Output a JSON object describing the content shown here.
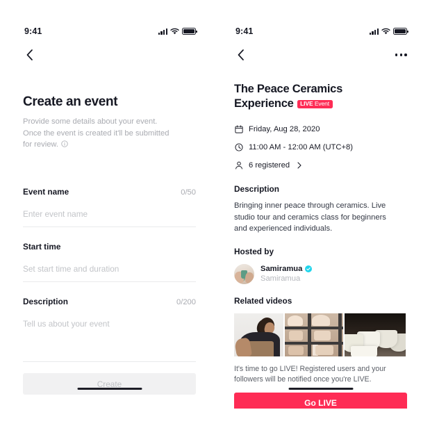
{
  "theme": {
    "accent": "#FE2C55",
    "text_primary": "#161823",
    "text_muted": "#A9ABB1",
    "divider": "#E9EAEC",
    "disabled_bg": "#F1F1F2",
    "verified_blue": "#20D5EC"
  },
  "left_screen": {
    "status_bar": {
      "time": "9:41",
      "signal_icon": "cellular-signal-icon",
      "wifi_icon": "wifi-icon",
      "battery_icon": "battery-icon"
    },
    "nav": {
      "back_icon": "chevron-left-icon"
    },
    "title": "Create an event",
    "subtitle": "Provide some details about your event. Once the event is created it'll be submitted for review.",
    "subtitle_info_icon": "info-circle-icon",
    "fields": [
      {
        "label": "Event name",
        "counter": "0/50",
        "placeholder": "Enter event name",
        "value": ""
      },
      {
        "label": "Start time",
        "counter": "",
        "placeholder": "Set start time and duration",
        "value": ""
      },
      {
        "label": "Description",
        "counter": "0/200",
        "placeholder": "Tell us about your event",
        "value": ""
      }
    ],
    "submit_label": "Create",
    "submit_enabled": false
  },
  "right_screen": {
    "status_bar": {
      "time": "9:41",
      "signal_icon": "cellular-signal-icon",
      "wifi_icon": "wifi-icon",
      "battery_icon": "battery-icon"
    },
    "nav": {
      "back_icon": "chevron-left-icon",
      "more_icon": "more-horizontal-icon"
    },
    "event_title": "The Peace Ceramics Experience",
    "live_badge": {
      "strong": "LIVE",
      "rest": " Event"
    },
    "meta": [
      {
        "icon": "calendar-icon",
        "text": "Friday, Aug 28, 2020",
        "chevron": false
      },
      {
        "icon": "clock-icon",
        "text": "11:00 AM - 12:00 AM (UTC+8)",
        "chevron": false
      },
      {
        "icon": "person-icon",
        "text": "6 registered",
        "chevron": true
      }
    ],
    "description_heading": "Description",
    "description_text": "Bringing inner peace through ceramics. Live studio tour and ceramics class for beginners and experienced individuals.",
    "hosted_by_heading": "Hosted by",
    "host": {
      "avatar_icon": "avatar",
      "display_name": "Samiramua",
      "verified": true,
      "verified_icon": "verified-badge-icon",
      "handle": "Samiramua"
    },
    "related_videos_heading": "Related videos",
    "thumbnails": [
      {
        "alt": "potter-working-thumbnail"
      },
      {
        "alt": "pottery-shelves-thumbnail"
      },
      {
        "alt": "white-bowls-thumbnail"
      },
      {
        "alt": "partial-thumbnail"
      }
    ],
    "notice": "It's time to go LIVE! Registered users and your followers will be notified once you're LIVE.",
    "golive_label": "Go LIVE"
  }
}
